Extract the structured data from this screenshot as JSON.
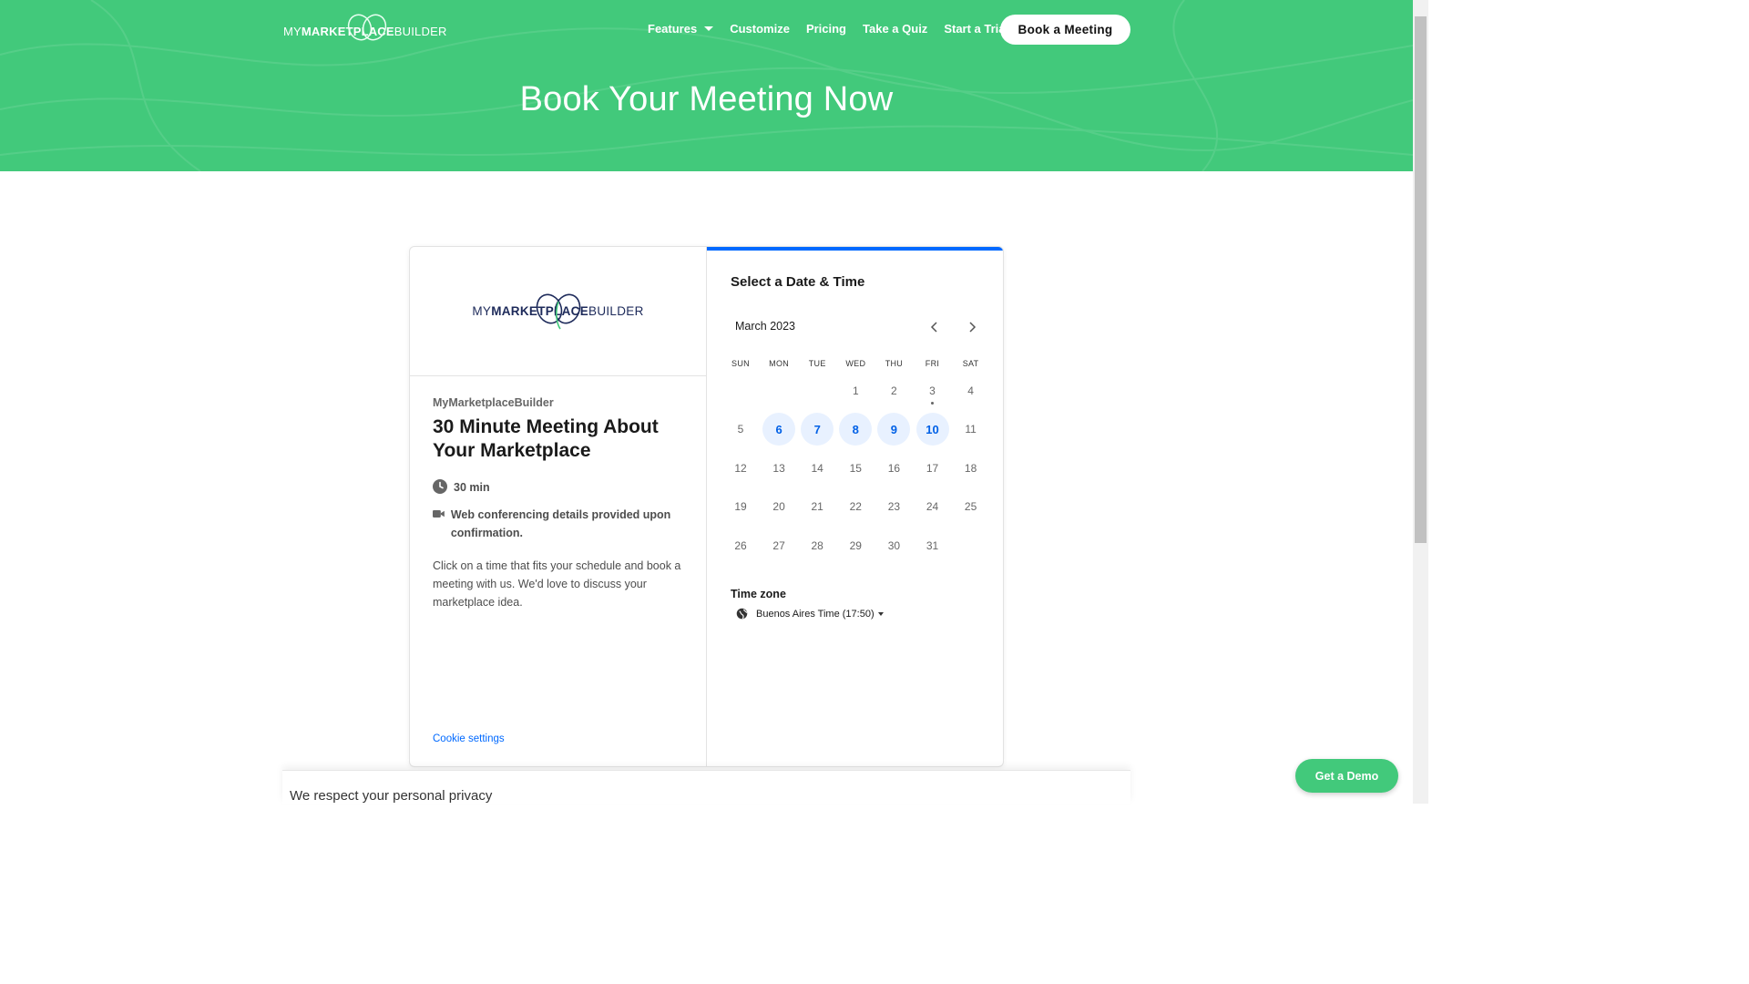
{
  "header": {
    "logo": {
      "prefix": "MY",
      "bold": "MARKETPLACE",
      "suffix": "BUILDER"
    },
    "nav": [
      "Features",
      "Customize",
      "Pricing",
      "Take a Quiz",
      "Start a Trial"
    ],
    "cta": "Book a Meeting",
    "hero_title": "Book Your Meeting Now"
  },
  "event": {
    "logo": {
      "prefix": "MY",
      "bold": "MARKETPLACE",
      "suffix": "BUILDER"
    },
    "organizer": "MyMarketplaceBuilder",
    "title": "30 Minute Meeting About Your Marketplace",
    "duration": "30 min",
    "location": "Web conferencing details provided upon confirmation.",
    "description": "Click on a time that fits your schedule and book a meeting with us. We'd love to discuss your marketplace idea.",
    "cookie_link": "Cookie settings"
  },
  "calendar": {
    "heading": "Select a Date & Time",
    "month": "March 2023",
    "weekdays": [
      "SUN",
      "MON",
      "TUE",
      "WED",
      "THU",
      "FRI",
      "SAT"
    ],
    "first_weekday_index": 3,
    "days_in_month": 31,
    "available_days": [
      6,
      7,
      8,
      9,
      10
    ],
    "today": 3,
    "timezone_label": "Time zone",
    "timezone_value": "Buenos Aires Time (17:50)"
  },
  "privacy_banner": "We respect your personal privacy",
  "demo_button": "Get a Demo",
  "colors": {
    "brand_green": "#42c97b",
    "accent_blue": "#0069ff"
  }
}
